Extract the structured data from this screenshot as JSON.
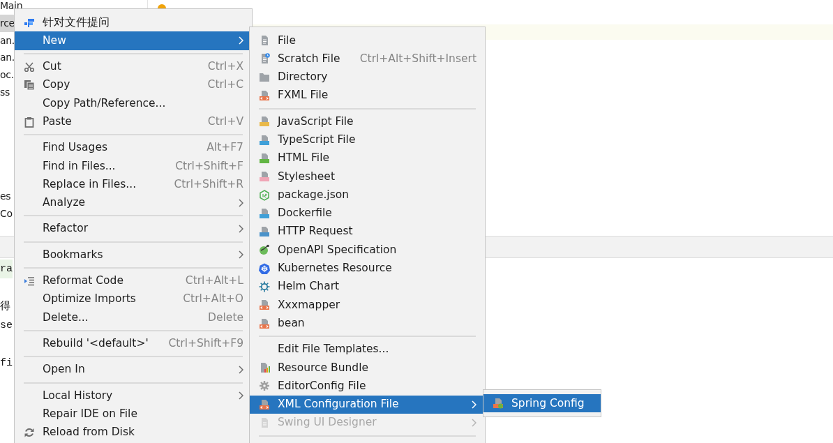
{
  "project_tree": {
    "items": [
      {
        "label": "Main",
        "selected": false
      },
      {
        "label": "rce",
        "selected": true
      },
      {
        "label": "an.",
        "selected": false
      },
      {
        "label": "an.",
        "selected": false
      },
      {
        "label": "oc.",
        "selected": false
      },
      {
        "label": "ss",
        "selected": false
      },
      {
        "label": "es",
        "selected": false
      },
      {
        "label": "Co",
        "selected": false
      }
    ]
  },
  "editor_lines": [
    {
      "text": "ra",
      "highlighted": true
    },
    {
      "text": "得",
      "highlighted": false
    },
    {
      "text": "se",
      "highlighted": false
    },
    {
      "text": "fi",
      "highlighted": false
    }
  ],
  "context_menu": {
    "items": [
      {
        "kind": "item",
        "label": "针对文件提问",
        "submenu": false,
        "selected": false
      },
      {
        "kind": "item",
        "label": "New",
        "submenu": true,
        "selected": true
      },
      {
        "kind": "separator"
      },
      {
        "kind": "item",
        "label": "Cut",
        "shortcut": "Ctrl+X",
        "submenu": false,
        "selected": false
      },
      {
        "kind": "item",
        "label": "Copy",
        "shortcut": "Ctrl+C",
        "submenu": false,
        "selected": false
      },
      {
        "kind": "item",
        "label": "Copy Path/Reference...",
        "submenu": false,
        "selected": false
      },
      {
        "kind": "item",
        "label": "Paste",
        "shortcut": "Ctrl+V",
        "submenu": false,
        "selected": false
      },
      {
        "kind": "separator"
      },
      {
        "kind": "item",
        "label": "Find Usages",
        "shortcut": "Alt+F7",
        "submenu": false,
        "selected": false
      },
      {
        "kind": "item",
        "label": "Find in Files...",
        "shortcut": "Ctrl+Shift+F",
        "submenu": false,
        "selected": false
      },
      {
        "kind": "item",
        "label": "Replace in Files...",
        "shortcut": "Ctrl+Shift+R",
        "submenu": false,
        "selected": false
      },
      {
        "kind": "item",
        "label": "Analyze",
        "submenu": true,
        "selected": false
      },
      {
        "kind": "separator"
      },
      {
        "kind": "item",
        "label": "Refactor",
        "submenu": true,
        "selected": false
      },
      {
        "kind": "separator"
      },
      {
        "kind": "item",
        "label": "Bookmarks",
        "submenu": true,
        "selected": false
      },
      {
        "kind": "separator"
      },
      {
        "kind": "item",
        "label": "Reformat Code",
        "shortcut": "Ctrl+Alt+L",
        "submenu": false,
        "selected": false
      },
      {
        "kind": "item",
        "label": "Optimize Imports",
        "shortcut": "Ctrl+Alt+O",
        "submenu": false,
        "selected": false
      },
      {
        "kind": "item",
        "label": "Delete...",
        "shortcut": "Delete",
        "submenu": false,
        "selected": false
      },
      {
        "kind": "separator"
      },
      {
        "kind": "item",
        "label": "Rebuild '<default>'",
        "shortcut": "Ctrl+Shift+F9",
        "submenu": false,
        "selected": false
      },
      {
        "kind": "separator"
      },
      {
        "kind": "item",
        "label": "Open In",
        "submenu": true,
        "selected": false
      },
      {
        "kind": "separator"
      },
      {
        "kind": "item",
        "label": "Local History",
        "submenu": true,
        "selected": false
      },
      {
        "kind": "item",
        "label": "Repair IDE on File",
        "submenu": false,
        "selected": false
      },
      {
        "kind": "item",
        "label": "Reload from Disk",
        "submenu": false,
        "selected": false
      }
    ]
  },
  "new_submenu": {
    "items": [
      {
        "kind": "item",
        "label": "File",
        "submenu": false,
        "selected": false,
        "disabled": false
      },
      {
        "kind": "item",
        "label": "Scratch File",
        "shortcut": "Ctrl+Alt+Shift+Insert",
        "submenu": false,
        "selected": false,
        "disabled": false
      },
      {
        "kind": "item",
        "label": "Directory",
        "submenu": false,
        "selected": false,
        "disabled": false
      },
      {
        "kind": "item",
        "label": "FXML File",
        "submenu": false,
        "selected": false,
        "disabled": false
      },
      {
        "kind": "separator"
      },
      {
        "kind": "item",
        "label": "JavaScript File",
        "submenu": false,
        "selected": false,
        "disabled": false
      },
      {
        "kind": "item",
        "label": "TypeScript File",
        "submenu": false,
        "selected": false,
        "disabled": false
      },
      {
        "kind": "item",
        "label": "HTML File",
        "submenu": false,
        "selected": false,
        "disabled": false
      },
      {
        "kind": "item",
        "label": "Stylesheet",
        "submenu": false,
        "selected": false,
        "disabled": false
      },
      {
        "kind": "item",
        "label": "package.json",
        "submenu": false,
        "selected": false,
        "disabled": false
      },
      {
        "kind": "item",
        "label": "Dockerfile",
        "submenu": false,
        "selected": false,
        "disabled": false
      },
      {
        "kind": "item",
        "label": "HTTP Request",
        "submenu": false,
        "selected": false,
        "disabled": false
      },
      {
        "kind": "item",
        "label": "OpenAPI Specification",
        "submenu": false,
        "selected": false,
        "disabled": false
      },
      {
        "kind": "item",
        "label": "Kubernetes Resource",
        "submenu": false,
        "selected": false,
        "disabled": false
      },
      {
        "kind": "item",
        "label": "Helm Chart",
        "submenu": false,
        "selected": false,
        "disabled": false
      },
      {
        "kind": "item",
        "label": "Xxxmapper",
        "submenu": false,
        "selected": false,
        "disabled": false
      },
      {
        "kind": "item",
        "label": "bean",
        "submenu": false,
        "selected": false,
        "disabled": false
      },
      {
        "kind": "separator"
      },
      {
        "kind": "item",
        "label": "Edit File Templates...",
        "submenu": false,
        "selected": false,
        "disabled": false
      },
      {
        "kind": "item",
        "label": "Resource Bundle",
        "submenu": false,
        "selected": false,
        "disabled": false
      },
      {
        "kind": "item",
        "label": "EditorConfig File",
        "submenu": false,
        "selected": false,
        "disabled": false
      },
      {
        "kind": "item",
        "label": "XML Configuration File",
        "submenu": true,
        "selected": true,
        "disabled": false
      },
      {
        "kind": "item",
        "label": "Swing UI Designer",
        "submenu": true,
        "selected": false,
        "disabled": true
      },
      {
        "kind": "separator"
      }
    ]
  },
  "xml_submenu": {
    "items": [
      {
        "kind": "item",
        "label": "Spring Config",
        "submenu": false,
        "selected": true,
        "disabled": false
      }
    ]
  }
}
